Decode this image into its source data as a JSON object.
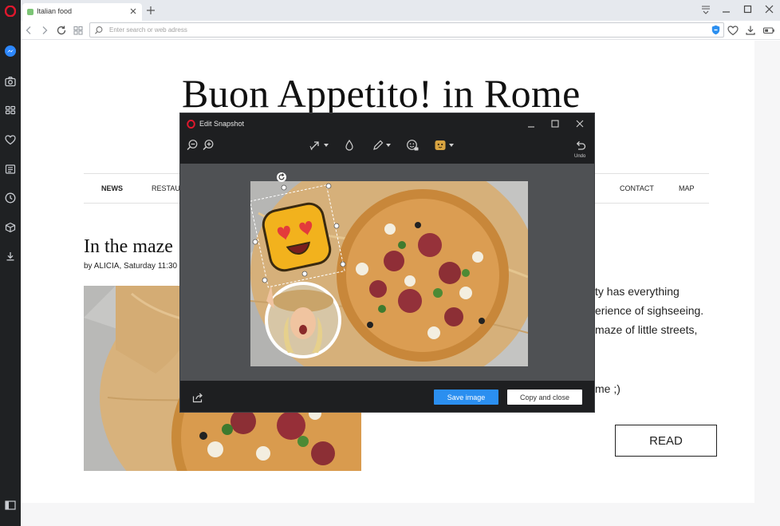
{
  "browser": {
    "tab_title": "Italian food",
    "address_placeholder": "Enter search or web adress"
  },
  "page": {
    "headline": "Buon Appetito! in Rome",
    "nav": [
      "NEWS",
      "RESTAU",
      "CONTACT",
      "MAP"
    ],
    "article_title": "In the maze",
    "byline": "by ALICIA, Saturday 11:30",
    "body_lines": [
      "ty has everything",
      "erience of sighseeing.",
      " maze of little streets,",
      "me ;)"
    ],
    "read_label": "READ"
  },
  "snapshot": {
    "title": "Edit Snapshot",
    "undo_label": "Undo",
    "save_label": "Save image",
    "copy_label": "Copy and close"
  },
  "colors": {
    "sidebar": "#1f2123",
    "accent": "#2b8ff0",
    "opera_red": "#e0182d",
    "dialog_bg": "#1e1f21",
    "canvas_bg": "#4f5154"
  }
}
